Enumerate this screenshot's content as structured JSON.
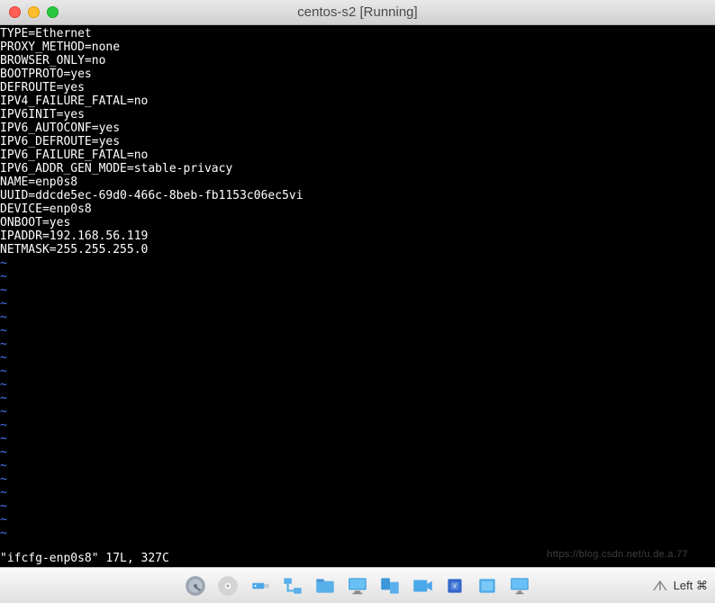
{
  "window": {
    "title": "centos-s2 [Running]"
  },
  "terminal": {
    "lines": [
      "TYPE=Ethernet",
      "PROXY_METHOD=none",
      "BROWSER_ONLY=no",
      "BOOTPROTO=yes",
      "DEFROUTE=yes",
      "IPV4_FAILURE_FATAL=no",
      "IPV6INIT=yes",
      "IPV6_AUTOCONF=yes",
      "IPV6_DEFROUTE=yes",
      "IPV6_FAILURE_FATAL=no",
      "IPV6_ADDR_GEN_MODE=stable-privacy",
      "NAME=enp0s8",
      "UUID=ddcde5ec-69d0-466c-8beb-fb1153c06ec5vi",
      "DEVICE=enp0s8",
      "ONBOOT=yes",
      "IPADDR=192.168.56.119",
      "NETMASK=255.255.255.0"
    ],
    "tilde": "~",
    "status": "\"ifcfg-enp0s8\" 17L, 327C"
  },
  "toolbar": {
    "icons": [
      "hard-drive-icon",
      "optical-disc-icon",
      "usb-icon",
      "network-icon",
      "shared-folder-icon",
      "display-icon",
      "audio-icon",
      "recording-icon",
      "processor-icon",
      "mouse-icon",
      "keyboard-icon"
    ]
  },
  "status": {
    "right": "Left ⌘"
  },
  "watermark": "https://blog.csdn.net/u.de.a.77"
}
